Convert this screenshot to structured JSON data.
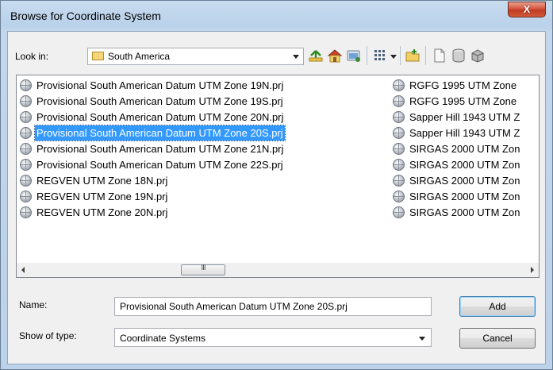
{
  "window": {
    "title": "Browse for Coordinate System",
    "close_label": "X"
  },
  "lookin": {
    "label": "Look in:",
    "value": "South America"
  },
  "toolbar": {
    "icons": [
      "up-one-level-icon",
      "home-icon",
      "connect-folder-icon",
      "view-menu-icon",
      "new-folder-icon",
      "new-file-icon",
      "catalog-icon",
      "options-icon"
    ]
  },
  "files": {
    "column1": [
      "Provisional South American Datum UTM Zone 19N.prj",
      "Provisional South American Datum UTM Zone 19S.prj",
      "Provisional South American Datum UTM Zone 20N.prj",
      "Provisional South American Datum UTM Zone 20S.prj",
      "Provisional South American Datum UTM Zone 21N.prj",
      "Provisional South American Datum UTM Zone 22S.prj",
      "REGVEN UTM Zone 18N.prj",
      "REGVEN UTM Zone 19N.prj",
      "REGVEN UTM Zone 20N.prj"
    ],
    "column2": [
      "RGFG 1995 UTM Zone",
      "RGFG 1995 UTM Zone",
      "Sapper Hill 1943 UTM Z",
      "Sapper Hill 1943 UTM Z",
      "SIRGAS 2000 UTM Zon",
      "SIRGAS 2000 UTM Zon",
      "SIRGAS 2000 UTM Zon",
      "SIRGAS 2000 UTM Zon",
      "SIRGAS 2000 UTM Zon"
    ],
    "selected": "Provisional South American Datum UTM Zone 20S.prj"
  },
  "scrollbar": {
    "thumb_grip": "III"
  },
  "name_field": {
    "label": "Name:",
    "value": "Provisional South American Datum UTM Zone 20S.prj"
  },
  "type_field": {
    "label": "Show of type:",
    "value": "Coordinate Systems"
  },
  "buttons": {
    "add": "Add",
    "cancel": "Cancel"
  }
}
